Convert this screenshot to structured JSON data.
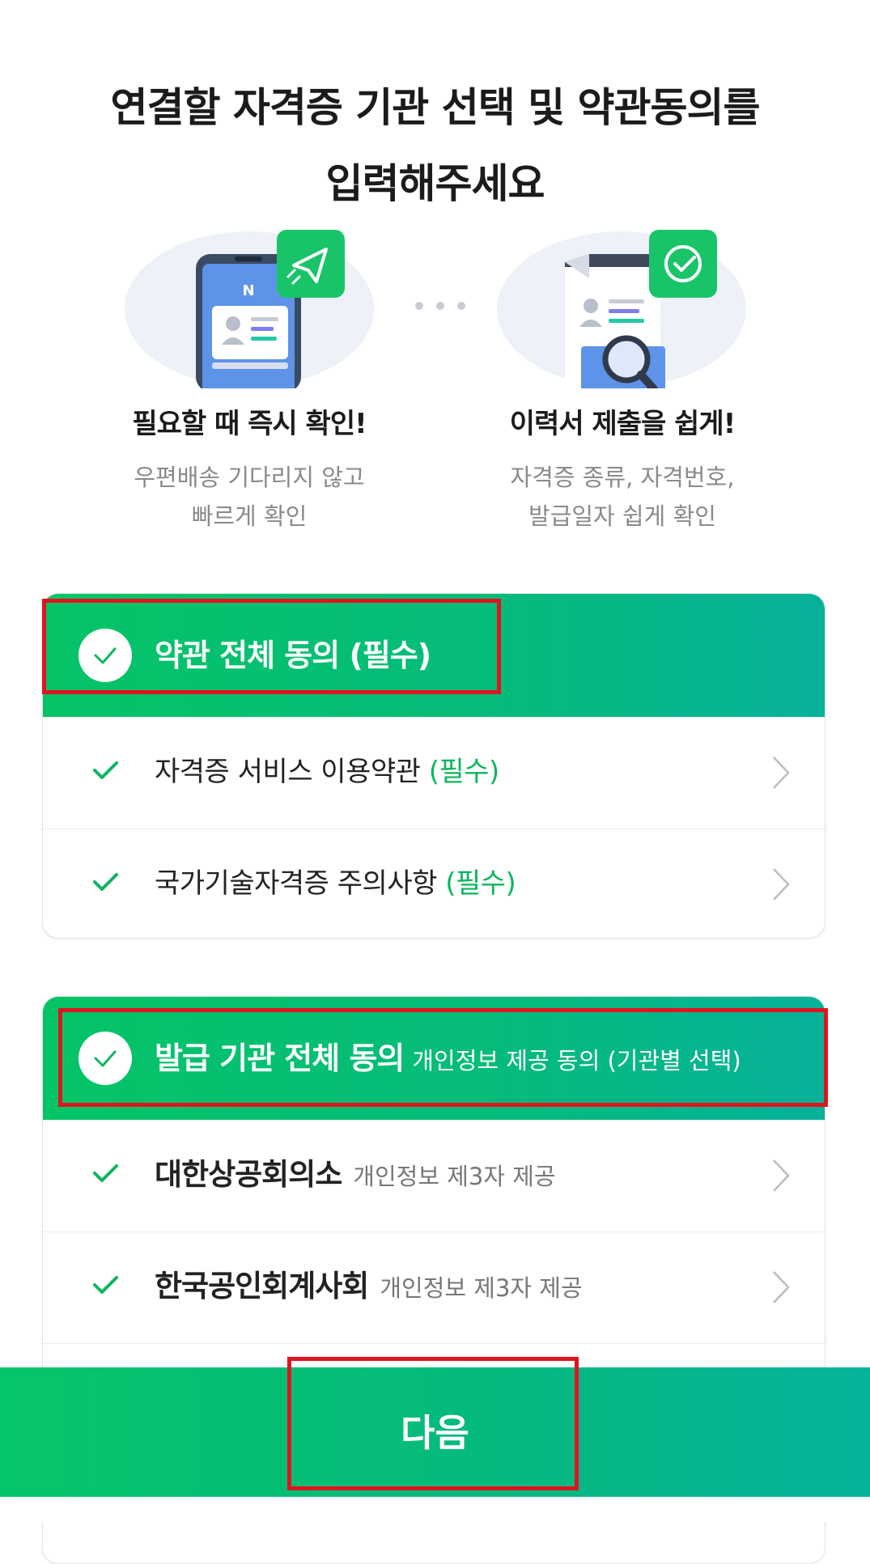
{
  "header": {
    "title_line1": "연결할 자격증 기관 선택 및 약관동의를",
    "title_line2": "입력해주세요"
  },
  "features": [
    {
      "title": "필요할 때 즉시 확인!",
      "desc_line1": "우편배송 기다리지 않고",
      "desc_line2": "빠르게 확인",
      "icon": "phone-id-icon"
    },
    {
      "title": "이력서 제출을 쉽게!",
      "desc_line1": "자격증 종류, 자격번호,",
      "desc_line2": "발급일자 쉽게 확인",
      "icon": "document-check-icon"
    }
  ],
  "terms_card": {
    "head_label": "약관 전체 동의 (필수)",
    "items": [
      {
        "label": "자격증 서비스 이용약관",
        "required": "(필수)"
      },
      {
        "label": "국가기술자격증 주의사항",
        "required": "(필수)"
      }
    ]
  },
  "issuer_card": {
    "head_label": "발급 기관 전체 동의",
    "head_sub": "개인정보 제공 동의 (기관별 선택)",
    "items": [
      {
        "label": "대한상공회의소",
        "sub": "개인정보 제3자 제공"
      },
      {
        "label": "한국공인회계사회",
        "sub": "개인정보 제3자 제공"
      }
    ]
  },
  "footer": {
    "next_label": "다음"
  },
  "colors": {
    "accent": "#05c466",
    "accent_end": "#07b19a",
    "required_text": "#0cb65e",
    "highlight": "#e0141e"
  }
}
